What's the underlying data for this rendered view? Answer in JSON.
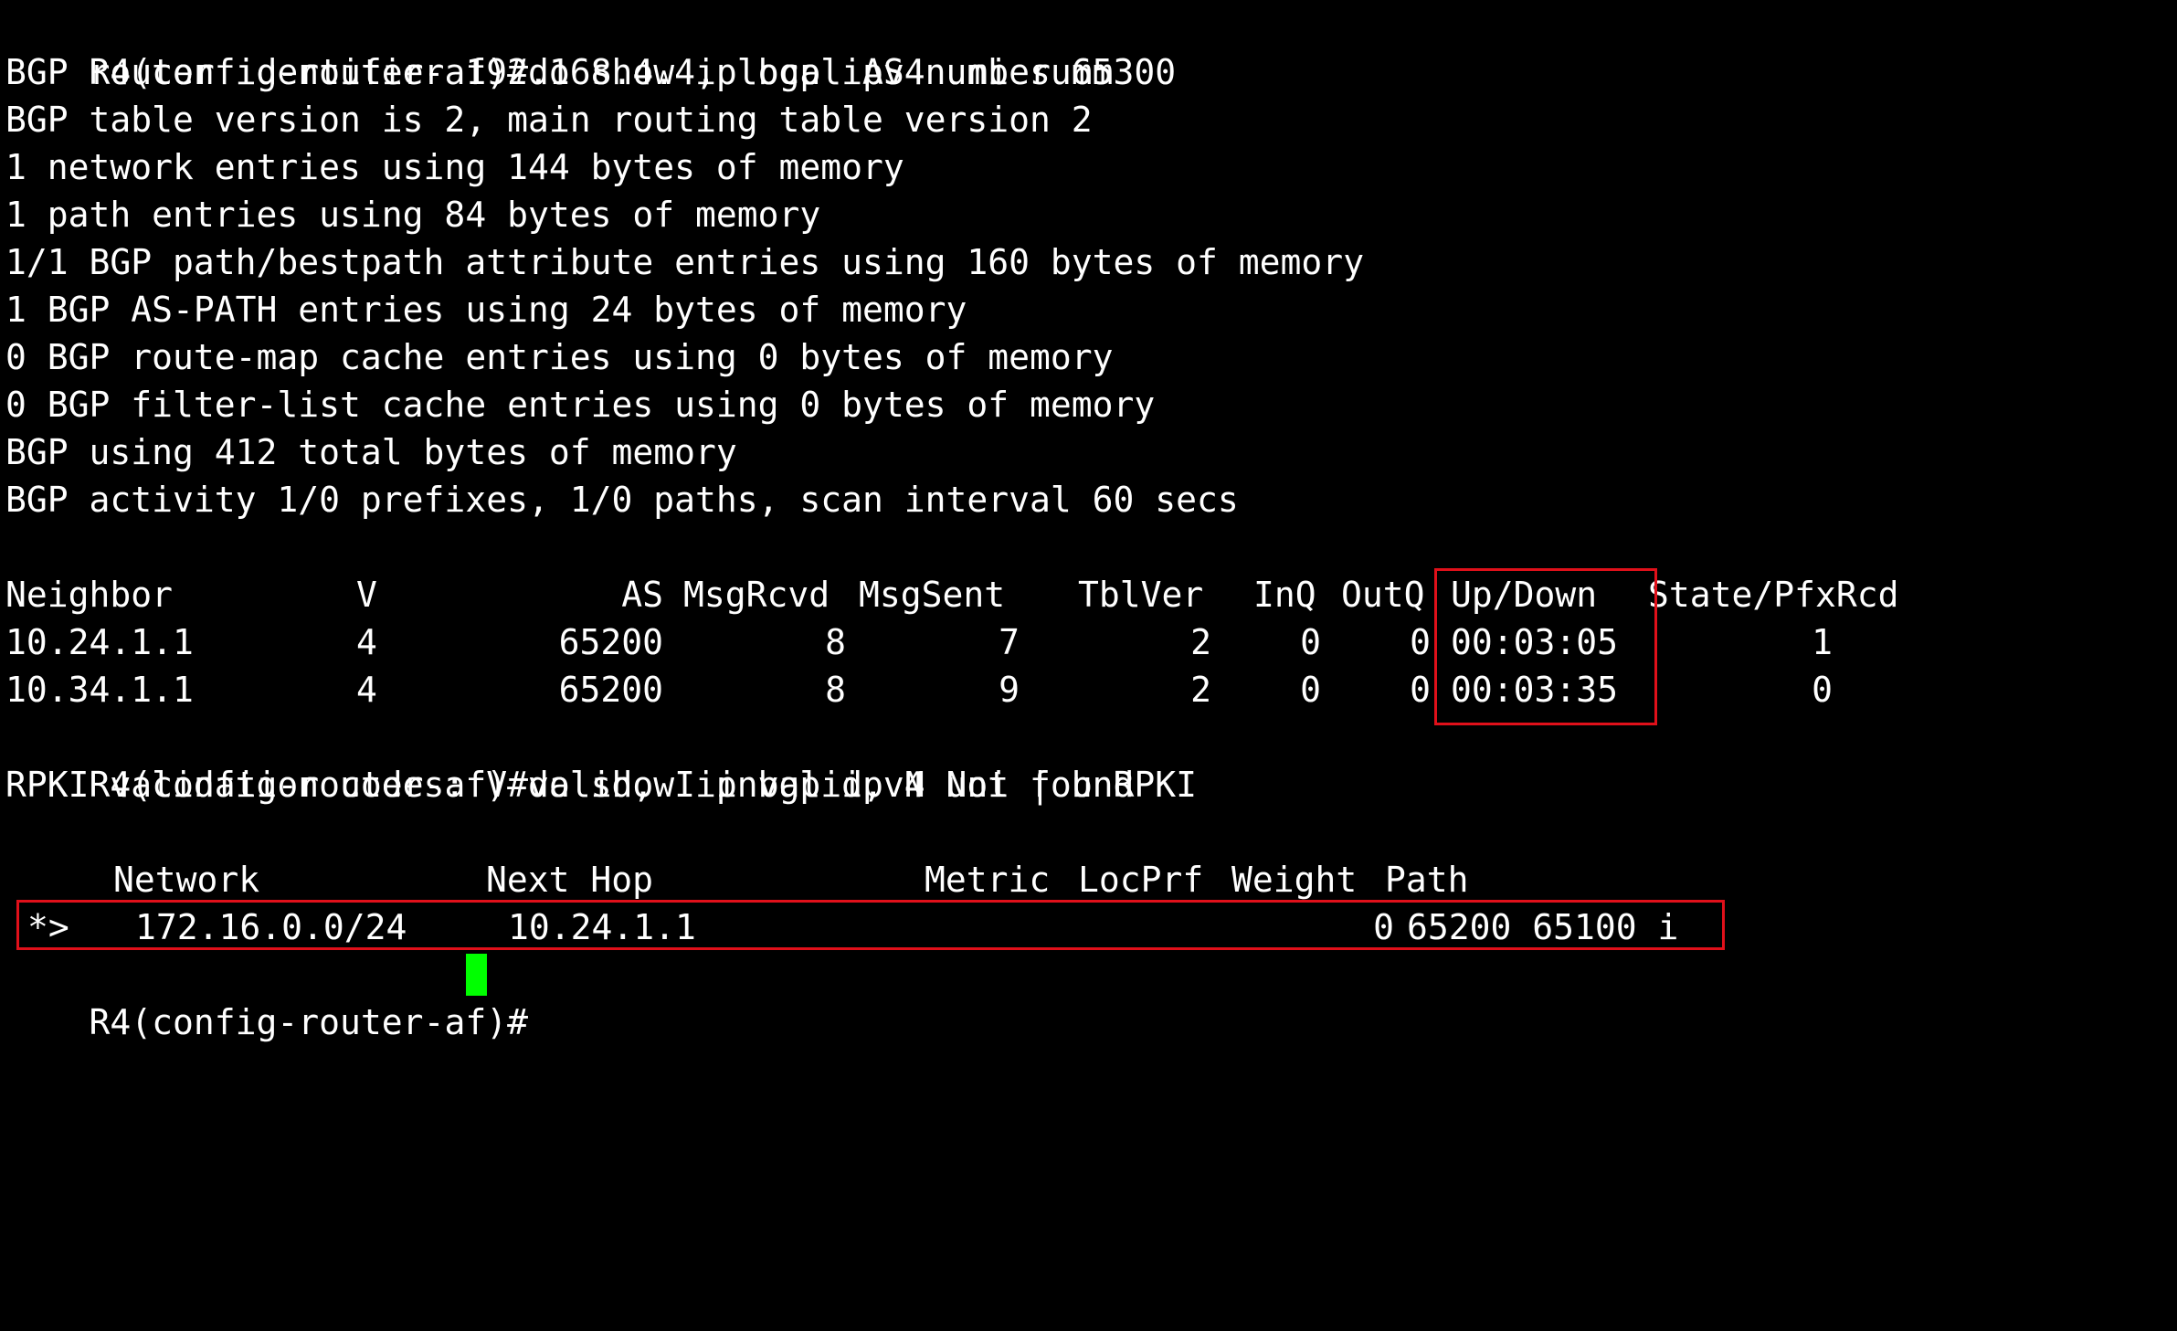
{
  "terminal": {
    "summary_command": {
      "prompt": "R4(config-router-af)#",
      "command": "do show ip bgp ipv4 uni summ"
    },
    "summary_lines": [
      "BGP router identifier 192.168.4.4, local AS number 65300",
      "BGP table version is 2, main routing table version 2",
      "1 network entries using 144 bytes of memory",
      "1 path entries using 84 bytes of memory",
      "1/1 BGP path/bestpath attribute entries using 160 bytes of memory",
      "1 BGP AS-PATH entries using 24 bytes of memory",
      "0 BGP route-map cache entries using 0 bytes of memory",
      "0 BGP filter-list cache entries using 0 bytes of memory",
      "BGP using 412 total bytes of memory",
      "BGP activity 1/0 prefixes, 1/0 paths, scan interval 60 secs"
    ],
    "neighbor_table": {
      "headers": {
        "neighbor": "Neighbor",
        "v": "V",
        "as": "AS",
        "msgrcvd": "MsgRcvd",
        "msgsent": "MsgSent",
        "tblver": "TblVer",
        "inq": "InQ",
        "outq": "OutQ",
        "updown": "Up/Down",
        "state": "State/PfxRcd"
      },
      "rows": [
        {
          "neighbor": "10.24.1.1",
          "v": "4",
          "as": "65200",
          "msgrcvd": "8",
          "msgsent": "7",
          "tblver": "2",
          "inq": "0",
          "outq": "0",
          "updown": "00:03:05",
          "state": "1"
        },
        {
          "neighbor": "10.34.1.1",
          "v": "4",
          "as": "65200",
          "msgrcvd": "8",
          "msgsent": "9",
          "tblver": "2",
          "inq": "0",
          "outq": "0",
          "updown": "00:03:35",
          "state": "0"
        }
      ]
    },
    "rpki_command": {
      "prompt": "R4(config-router-af)#",
      "command": "do show ip bgp ipv4 uni | b RPKI"
    },
    "rpki_legend": "RPKI validation codes: V valid, I invalid, N Not found",
    "route_table": {
      "headers": {
        "network": "Network",
        "nexthop": "Next Hop",
        "metric": "Metric",
        "locprf": "LocPrf",
        "weight": "Weight",
        "path": "Path"
      },
      "rows": [
        {
          "status": "*>",
          "network": "172.16.0.0/24",
          "nexthop": "10.24.1.1",
          "metric": "",
          "locprf": "",
          "weight": "0",
          "path": "65200 65100 i"
        }
      ]
    },
    "final_prompt": "R4(config-router-af)#"
  },
  "colors": {
    "background": "#000000",
    "text": "#ffffff",
    "highlight_box": "#e0101a",
    "cursor": "#00ff00"
  }
}
